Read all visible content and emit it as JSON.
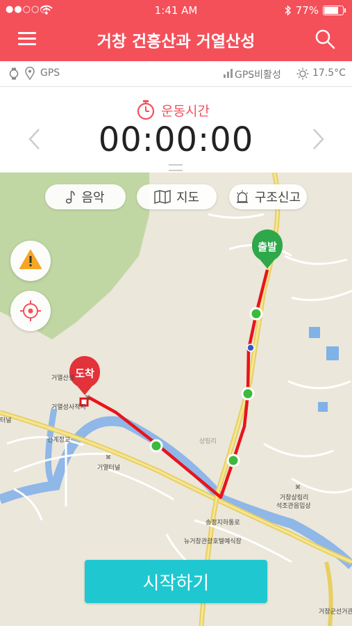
{
  "status_bar": {
    "signal": "●●○○○",
    "time": "1:41 AM",
    "battery": "77%",
    "battery_level": 0.77
  },
  "header": {
    "title": "거창 건흥산과 거열산성"
  },
  "info_bar": {
    "gps_label": "GPS",
    "gps_status": "GPS비활성",
    "temperature": "17.5°C"
  },
  "timer": {
    "label": "운동시간",
    "value": "00:00:00"
  },
  "map_controls": {
    "music": "음악",
    "map": "지도",
    "rescue": "구조신고"
  },
  "markers": {
    "start": "출발",
    "end": "도착"
  },
  "map_labels": {
    "fortress": "거열산성",
    "temple": "거열성사적지",
    "bridge": "건계정교",
    "tunnel": "거열터널",
    "village": "상림리",
    "sangrim": "거창상림리",
    "sangrim2": "석조관음입상",
    "underpass": "송정지하통로",
    "hotel": "뉴거창관광호텔예식장",
    "left_edge": "터널",
    "bottom_right": "거창군선거관"
  },
  "start_button": "시작하기",
  "colors": {
    "brand": "#f4505a",
    "route": "#e8141a",
    "start_marker": "#2ea84a",
    "end_marker": "#e2323a",
    "waypoint": "#3cba3c",
    "start_button": "#1fc8d0"
  }
}
